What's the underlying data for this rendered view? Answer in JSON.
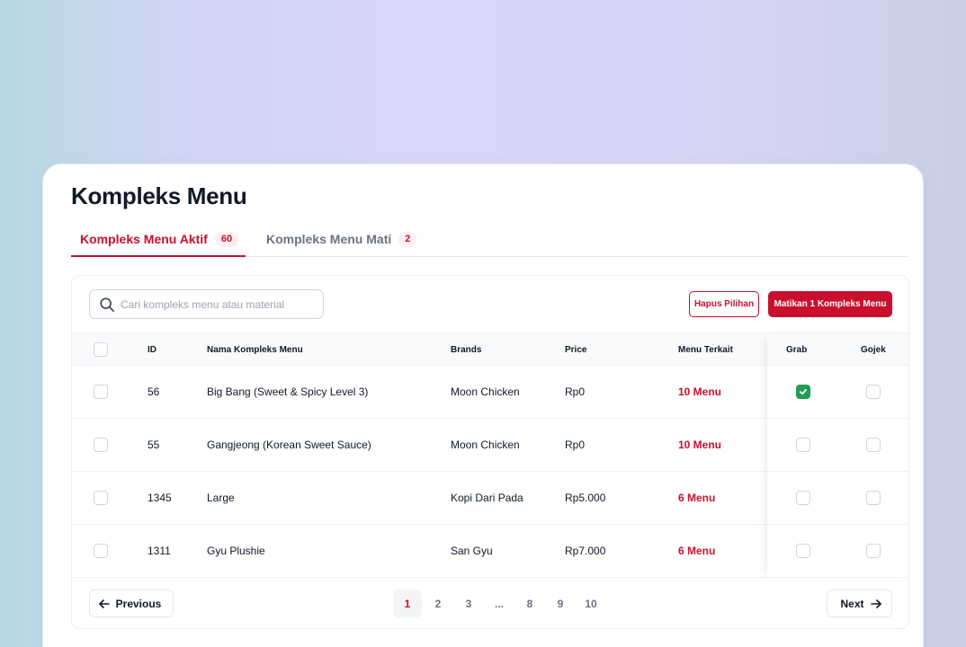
{
  "page": {
    "title": "Kompleks Menu"
  },
  "tabs": [
    {
      "label": "Kompleks Menu Aktif",
      "count": "60"
    },
    {
      "label": "Kompleks Menu Mati",
      "count": "2"
    }
  ],
  "toolbar": {
    "search_placeholder": "Cari kompleks menu atau material",
    "delete_label": "Hapus Pilihan",
    "deactivate_label": "Matikan 1 Kompleks Menu"
  },
  "table": {
    "headers": {
      "id": "ID",
      "name": "Nama Kompleks Menu",
      "brands": "Brands",
      "price": "Price",
      "related": "Menu Terkait",
      "grab": "Grab",
      "gojek": "Gojek"
    },
    "rows": [
      {
        "id": "56",
        "name": "Big Bang (Sweet & Spicy Level 3)",
        "brand": "Moon Chicken",
        "price": "Rp0",
        "related": "10 Menu",
        "grab": true,
        "gojek": false
      },
      {
        "id": "55",
        "name": "Gangjeong (Korean Sweet Sauce)",
        "brand": "Moon Chicken",
        "price": "Rp0",
        "related": "10 Menu",
        "grab": false,
        "gojek": false
      },
      {
        "id": "1345",
        "name": "Large",
        "brand": "Kopi Dari Pada",
        "price": "Rp5.000",
        "related": "6 Menu",
        "grab": false,
        "gojek": false
      },
      {
        "id": "1311",
        "name": "Gyu Plushie",
        "brand": "San Gyu",
        "price": "Rp7.000",
        "related": "6 Menu",
        "grab": false,
        "gojek": false
      }
    ]
  },
  "pagination": {
    "previous_label": "Previous",
    "next_label": "Next",
    "pages": [
      "1",
      "2",
      "3",
      "...",
      "8",
      "9",
      "10"
    ],
    "current": "1"
  },
  "colors": {
    "accent": "#c8102e",
    "check_green": "#1f9d55"
  }
}
